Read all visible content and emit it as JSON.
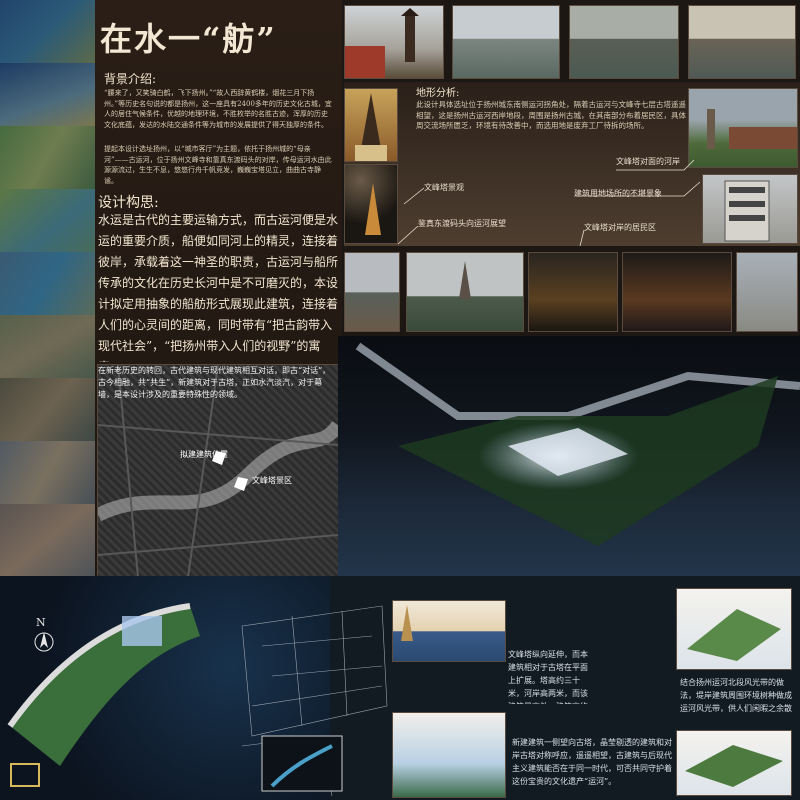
{
  "title": "在水一“舫”",
  "background": {
    "heading": "背景介绍:",
    "paragraph1": "“腰来了，又笑骑白鹤，飞下扬州。”“故人西辞黄鹤楼，烟花三月下扬州。”等历史名句说的都是扬州，这一座具有2400多年的历史文化古城，宜人的居住气候条件，优越的地理环境，不胜枚举的名胜古迹，浑厚的历史文化底蕴，发达的水陆交通条件等为城市的发展提供了得天独厚的条件。",
    "paragraph2": "提起本设计选址扬州，以“城市客厅”为主题，依托于扬州城的“母亲河”——古运河，位于扬州文峰寺和靠真东渡码头的对岸，传母运河水由此源源流过，生生不息，悠悠行舟千帆竞发，巍巍宝塔见立，曲曲古寺静谧。"
  },
  "design": {
    "heading": "设计构思:",
    "text": "水运是古代的主要运输方式，而古运河便是水运的重要介质，船便如同河上的精灵，连接着彼岸，承载着这一神圣的职责，古运河与船所传承的文化在历史长河中是不可磨灭的，本设计拟定用抽象的船舫形式展现此建筑，连接着人们的心灵间的距离，同时带有“把古韵带入现代社会”，“把扬州带入人们的视野”的寓意。",
    "text2": "在新老历史的转回，古代建筑与现代建筑相互对话，即古“对话”，古今相融，共“共生”，新建筑对于古塔，正如水汽淡汽，对于幕墙，是本设计涉及的重要特殊性的领域。",
    "map_label_site": "拟建建筑位置",
    "map_label_pagoda": "文峰塔景区"
  },
  "analysis": {
    "heading": "地形分析:",
    "text": "此设计具体选址位于扬州城东南侧运河拐角处，隔着古运河与文峰寺七层古塔遥遥相望，这是扬州古运河西岸地段，周围是扬州古城，在其南部分布着居民区，具体周交流场所匮乏，环境有待改善中，而选用地是废弃工厂待拆的场所。"
  },
  "captions": {
    "opposite_bank": "文峰塔对面的河岸",
    "pagoda_night": "文峰塔景观",
    "site_buildings": "建筑用地场所的不堪景象",
    "dock_view": "鉴真东渡码头向运河展望",
    "residential": "文峰塔对岸的居民区"
  },
  "compass_label": "N",
  "notes": {
    "note1": "文峰塔纵向延伸，而本建筑相对于古塔在平面上扩展。塔高约三十米，河岸高两米，而该建筑最高处，建筑高约十五米，在空间脉络上，使两建筑形成对比。",
    "note2": "新建建筑一侧望向古塔，晶莹剔透的建筑和对岸古塔对称呼应，遥遥相望，古建筑与后现代主义建筑能否在于同一时代，可否共同守护着这份宝贵的文化遗产“运河”。",
    "note3": "结合扬州运河北段风光带的做法，堤岸建筑周围环境树种做成运河风光带，供人们闲暇之余散步，小憩的场所。"
  },
  "colors": {
    "accent": "#d7b95c",
    "background": "#1c1712",
    "lower_background": "#121a22"
  }
}
